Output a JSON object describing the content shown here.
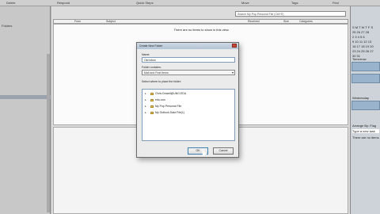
{
  "ribbon": {
    "labels": [
      "Delete",
      "Respond",
      "Quick Steps",
      "Move",
      "Tags",
      "Find"
    ]
  },
  "nav": {
    "items": [
      "Folders"
    ]
  },
  "search": {
    "placeholder": "Search My Pop Personal File (Ctrl+E)"
  },
  "list": {
    "columns": [
      "From",
      "Subject",
      "Received",
      "Size",
      "Categories"
    ],
    "empty_message": "There are no items to show in this view."
  },
  "dialog": {
    "title": "Create New Folder",
    "name_label": "Name:",
    "name_value": "Old inbox",
    "contains_label": "Folder contains:",
    "contains_value": "Mail and Post Items",
    "where_label": "Select where to place the folder:",
    "tree": [
      "Chris.Dowell@UNO.EDU",
      "edu.uno",
      "My Pop Personal File",
      "My Outlook Data File(1)"
    ],
    "ok_label": "OK",
    "cancel_label": "Cancel"
  },
  "todo": {
    "calendar": [
      "S M T W T F S",
      "25 26 27 28",
      "2  3  4  5  6",
      "9 10 11 12 13",
      "16 17 18 19 20",
      "23 24 25 26 27",
      "30 31"
    ],
    "tomorrow_label": "Tomorrow",
    "wednesday_label": "Wednesday",
    "arrange_label": "Arrange By: Flag",
    "task_placeholder": "Type a new task",
    "no_items": "There are no items"
  }
}
